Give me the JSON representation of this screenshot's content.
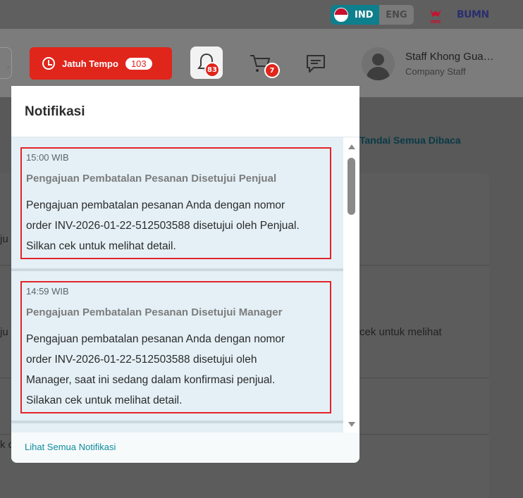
{
  "language": {
    "active": "IND",
    "other": "ENG"
  },
  "header": {
    "due_label": "Jatuh Tempo",
    "due_count": "103",
    "notification_count": "83",
    "cart_count": "7",
    "user_name": "Staff Khong Gua…",
    "user_role": "Company Staff"
  },
  "page": {
    "mark_all_read": "Tandai Semua Dibaca",
    "row_fragments": [
      "ju",
      "ju",
      "cek untuk melihat",
      "k c"
    ]
  },
  "notifications": {
    "title": "Notifikasi",
    "items": [
      {
        "time": "15:00 WIB",
        "subject": "Pengajuan Pembatalan Pesanan Disetujui Penjual",
        "lines": [
          "Pengajuan pembatalan pesanan Anda dengan nomor",
          "order INV-2026-01-22-512503588 disetujui oleh Penjual.",
          "Silkan cek untuk melihat detail."
        ]
      },
      {
        "time": "14:59 WIB",
        "subject": "Pengajuan Pembatalan Pesanan Disetujui Manager",
        "lines": [
          "Pengajuan pembatalan pesanan Anda dengan nomor",
          "order INV-2026-01-22-512503588 disetujui oleh",
          "Manager, saat ini sedang dalam konfirmasi penjual.",
          "Silakan cek untuk melihat detail."
        ]
      }
    ],
    "see_all": "Lihat Semua Notifikasi"
  },
  "colors": {
    "accent_teal": "#0e7f8c",
    "danger_red": "#e0251b",
    "highlight_border": "#e3242b",
    "unread_bg": "#e4f0f6"
  }
}
